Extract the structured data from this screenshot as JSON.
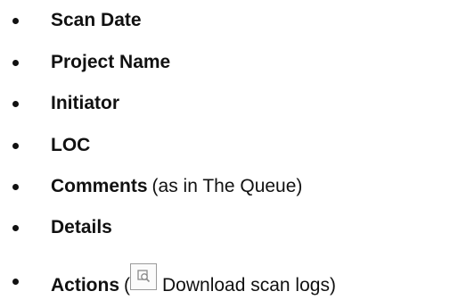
{
  "items": [
    {
      "bold": "Scan Date",
      "rest": ""
    },
    {
      "bold": "Project Name",
      "rest": ""
    },
    {
      "bold": "Initiator",
      "rest": ""
    },
    {
      "bold": "LOC",
      "rest": ""
    },
    {
      "bold": "Comments",
      "rest": "(as in The Queue)"
    },
    {
      "bold": "Details",
      "rest": ""
    },
    {
      "bold": "Actions",
      "rest_before_icon": "(",
      "rest_after_icon": "Download scan logs)"
    }
  ],
  "icons": {
    "download_logs": "download-scan-logs-icon"
  }
}
